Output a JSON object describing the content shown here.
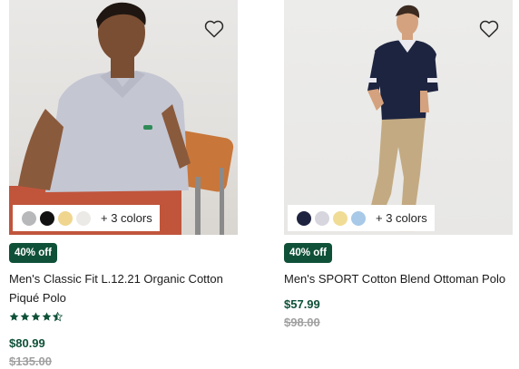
{
  "products": [
    {
      "image_alt": "Model wearing light grey polo seated on chair",
      "swatches": [
        "#b7b8ba",
        "#121212",
        "#efd58e",
        "#eceae6"
      ],
      "more_colors": "+ 3 colors",
      "badge": "40% off",
      "title": "Men's Classic Fit L.12.21 Organic Cotton Piqué Polo",
      "rating": 4.5,
      "price": "$80.99",
      "original_price": "$135.00"
    },
    {
      "image_alt": "Model wearing navy polo and khaki trousers",
      "swatches": [
        "#1e2340",
        "#d7d6df",
        "#f1dc95",
        "#a8c9e8"
      ],
      "more_colors": "+ 3 colors",
      "badge": "40% off",
      "title": "Men's SPORT Cotton Blend Ottoman Polo",
      "price": "$57.99",
      "original_price": "$98.00"
    }
  ],
  "colors": {
    "accent": "#0f5138",
    "strike": "#a0a0a0"
  },
  "icons": [
    "heart-outline-icon",
    "star-icon",
    "half-star-icon"
  ]
}
